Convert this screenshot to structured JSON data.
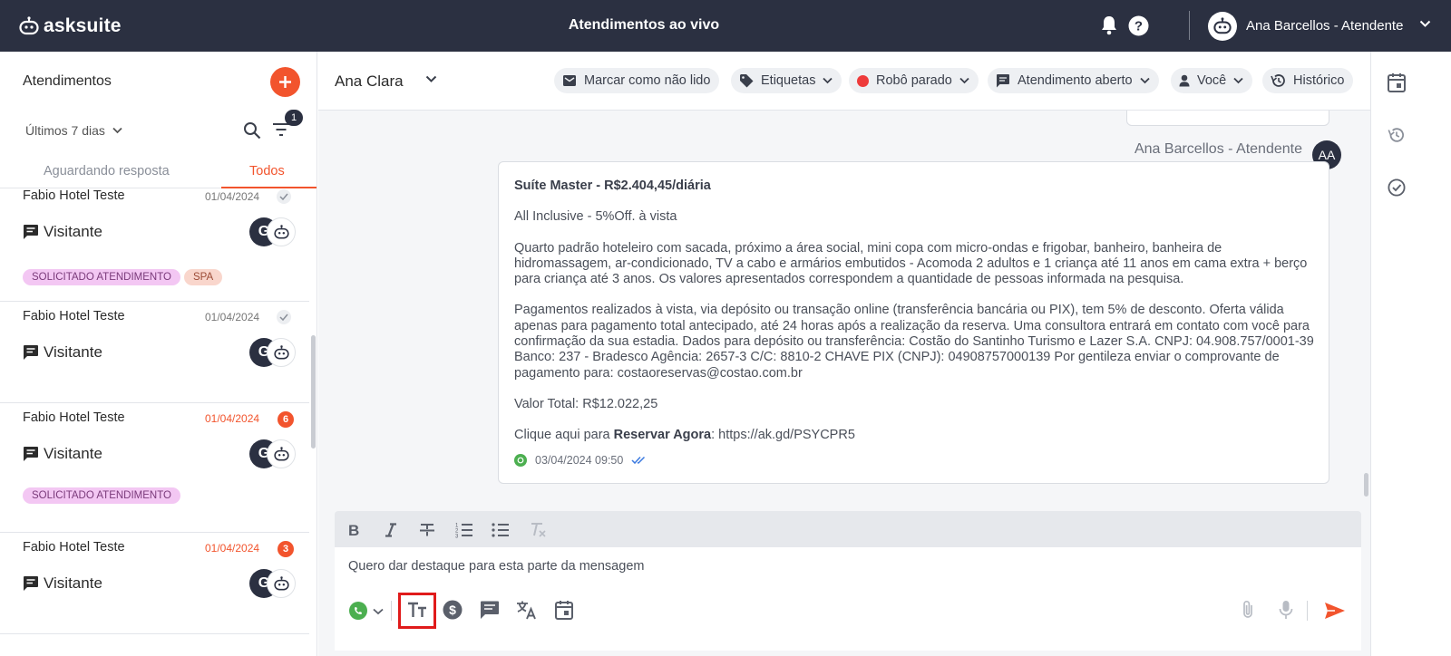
{
  "topbar": {
    "brand": "asksuite",
    "title": "Atendimentos ao vivo",
    "user_name": "Ana Barcellos - Atendente"
  },
  "sidebar": {
    "title": "Atendimentos",
    "period": "Últimos 7 dias",
    "filter_count": "1",
    "tabs": [
      {
        "label": "Aguardando resposta",
        "active": false
      },
      {
        "label": "Todos",
        "active": true
      }
    ],
    "conversations": [
      {
        "name": "Fabio Hotel Teste",
        "date": "01/04/2024",
        "visitor": "Visitante",
        "tags": [
          "SOLICITADO ATENDIMENTO",
          "SPA"
        ],
        "read": true
      },
      {
        "name": "Fabio Hotel Teste",
        "date": "01/04/2024",
        "visitor": "Visitante",
        "tags": [],
        "read": true
      },
      {
        "name": "Fabio Hotel Teste",
        "date": "01/04/2024",
        "visitor": "Visitante",
        "tags": [
          "SOLICITADO ATENDIMENTO"
        ],
        "unread": "6"
      },
      {
        "name": "Fabio Hotel Teste",
        "date": "01/04/2024",
        "visitor": "Visitante",
        "tags": [],
        "unread": "3"
      }
    ],
    "avatar_letter": "G"
  },
  "chat_header": {
    "contact": "Ana Clara",
    "actions": {
      "mark_unread": "Marcar como não lido",
      "labels": "Etiquetas",
      "robot": "Robô parado",
      "status": "Atendimento aberto",
      "assignee": "Você",
      "history": "Histórico"
    }
  },
  "message": {
    "sender": "Ana Barcellos - Atendente",
    "sender_initials": "AA",
    "title": "Suíte Master - R$2.404,45/diária",
    "offer": "All Inclusive - 5%Off. à vista",
    "description": "Quarto padrão hoteleiro com sacada, próximo a área social, mini copa com micro-ondas e frigobar, banheiro, banheira de hidromassagem, ar-condicionado, TV a cabo e armários embutidos - Acomoda 2 adultos e 1 criança até 11 anos em cama extra + berço para criança até 3 anos. Os valores apresentados correspondem a quantidade de pessoas informada na pesquisa.",
    "payment": "Pagamentos realizados à vista, via depósito ou transação online (transferência bancária ou PIX), tem 5% de desconto. Oferta válida apenas para pagamento total antecipado, até 24 horas após a realização da reserva. Uma consultora entrará em contato com você para confirmação da sua estadia. Dados para depósito ou transferência: Costão do Santinho Turismo e Lazer S.A. CNPJ: 04.908.757/0001-39 Banco: 237 - Bradesco Agência: 2657-3 C/C: 8810-2 CHAVE PIX (CNPJ): 04908757000139 Por gentileza enviar o comprovante de pagamento para: costaoreservas@costao.com.br",
    "total": "Valor Total: R$12.022,25",
    "cta_prefix": "Clique aqui para ",
    "cta_bold": "Reservar Agora",
    "cta_link": ": https://ak.gd/PSYCPR5",
    "timestamp": "03/04/2024 09:50"
  },
  "composer": {
    "text": "Quero dar destaque para esta parte da mensagem"
  },
  "colors": {
    "topbar": "#2b3041",
    "accent": "#f2542d",
    "highlight": "#e01b1b"
  }
}
